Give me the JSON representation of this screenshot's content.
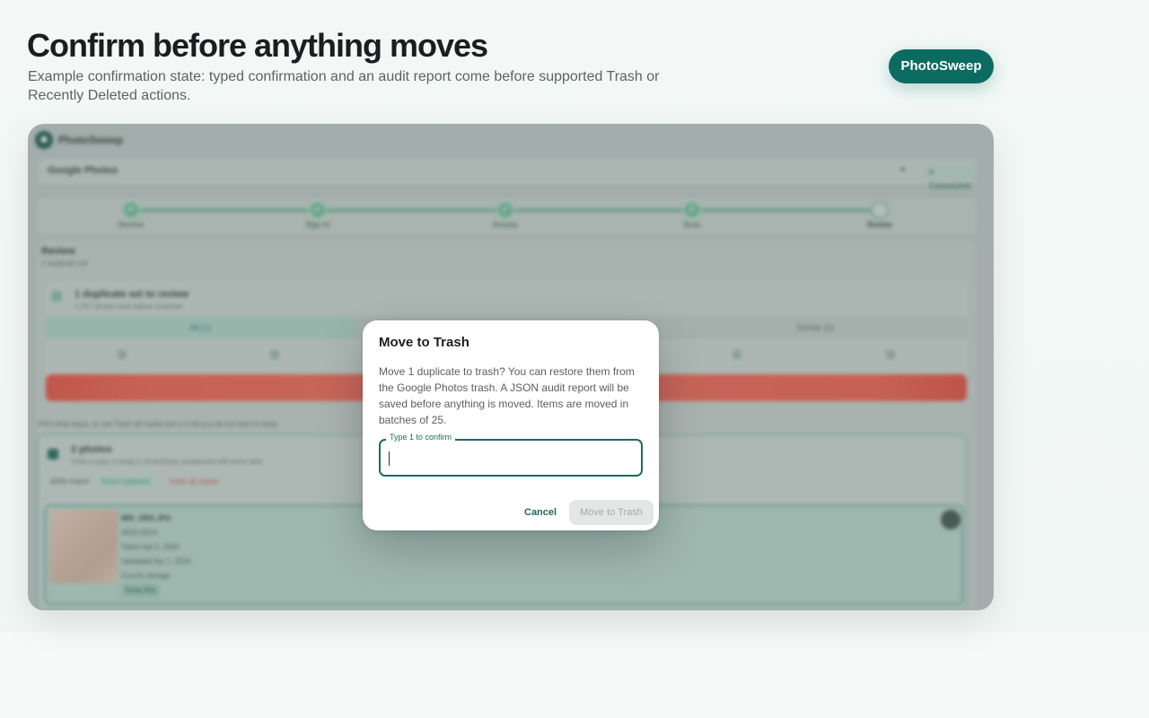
{
  "hero": {
    "title": "Confirm before anything moves",
    "subtitle": "Example confirmation state: typed confirmation and an audit report come before supported Trash or Recently Deleted actions.",
    "brand_pill": "PhotoSweep"
  },
  "app": {
    "name": "PhotoSweep",
    "source": {
      "label": "Google Photos",
      "status": "● Connected"
    },
    "steps": [
      {
        "label": "Service",
        "state": "done"
      },
      {
        "label": "Sign in",
        "state": "done"
      },
      {
        "label": "Access",
        "state": "done"
      },
      {
        "label": "Scan",
        "state": "done"
      },
      {
        "label": "Review",
        "state": "current"
      }
    ],
    "review": {
      "title": "Review",
      "subtitle": "1 duplicate set",
      "set": {
        "title": "1 duplicate set to review",
        "subtitle": "1,247 photos and videos scanned",
        "tab_exact": "All (1)",
        "tab_similar": "Similar (0)"
      },
      "hint": "Pick what stays, or use Trash all copies but 1 to let you do not want to keep",
      "photos": {
        "title": "2 photos",
        "subtitle": "Click a copy to keep it. Everything unselected will move later.",
        "chips": {
          "match": "100% match",
          "exact": "Exact duplicate",
          "trash_all": "Trash all copies"
        },
        "item": {
          "filename": "IMG_2901.JPG",
          "dimensions": "4032×3024",
          "taken": "Taken Apr 6, 2024",
          "uploaded": "Uploaded Apr 7, 2024",
          "storage": "Counts storage",
          "keep": "Keep this"
        }
      }
    }
  },
  "dialog": {
    "title": "Move to Trash",
    "body": "Move 1 duplicate to trash? You can restore them from the Google Photos trash. A JSON audit report will be saved before anything is moved. Items are moved in batches of 25.",
    "field_label": "Type 1 to confirm",
    "field_value": "",
    "cancel_label": "Cancel",
    "confirm_label": "Move to Trash"
  },
  "colors": {
    "accent": "#0c6b61",
    "danger": "#cf6558",
    "disabled_bg": "#e4e6e6",
    "disabled_text": "#a3a8a8"
  }
}
